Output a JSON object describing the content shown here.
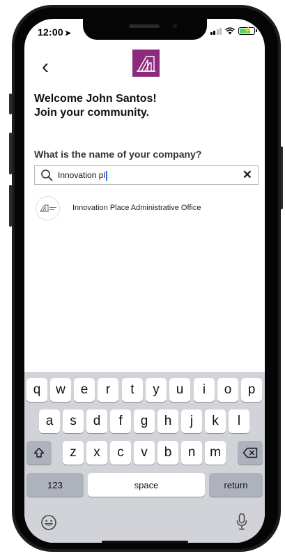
{
  "status_bar": {
    "time": "12:00",
    "location_glyph": "➤",
    "charging": true
  },
  "header": {
    "back_glyph": "‹"
  },
  "welcome": {
    "line1": "Welcome John Santos!",
    "line2": "Join your community."
  },
  "form": {
    "question": "What is the name of your company?",
    "search_value": "Innovation pl",
    "clear_glyph": "✕"
  },
  "results": [
    {
      "name": "Innovation Place Administrative Office"
    }
  ],
  "keyboard": {
    "row1": [
      "q",
      "w",
      "e",
      "r",
      "t",
      "y",
      "u",
      "i",
      "o",
      "p"
    ],
    "row2": [
      "a",
      "s",
      "d",
      "f",
      "g",
      "h",
      "j",
      "k",
      "l"
    ],
    "row3": [
      "z",
      "x",
      "c",
      "v",
      "b",
      "n",
      "m"
    ],
    "numbers_label": "123",
    "space_label": "space",
    "return_label": "return",
    "shift_icon": "shift-icon",
    "delete_icon": "backspace-icon",
    "emoji_icon": "emoji-icon",
    "mic_icon": "microphone-icon"
  },
  "colors": {
    "brand": "#8c2a7c",
    "keyboard_bg": "#d1d3d9",
    "caret": "#1f6fff"
  }
}
